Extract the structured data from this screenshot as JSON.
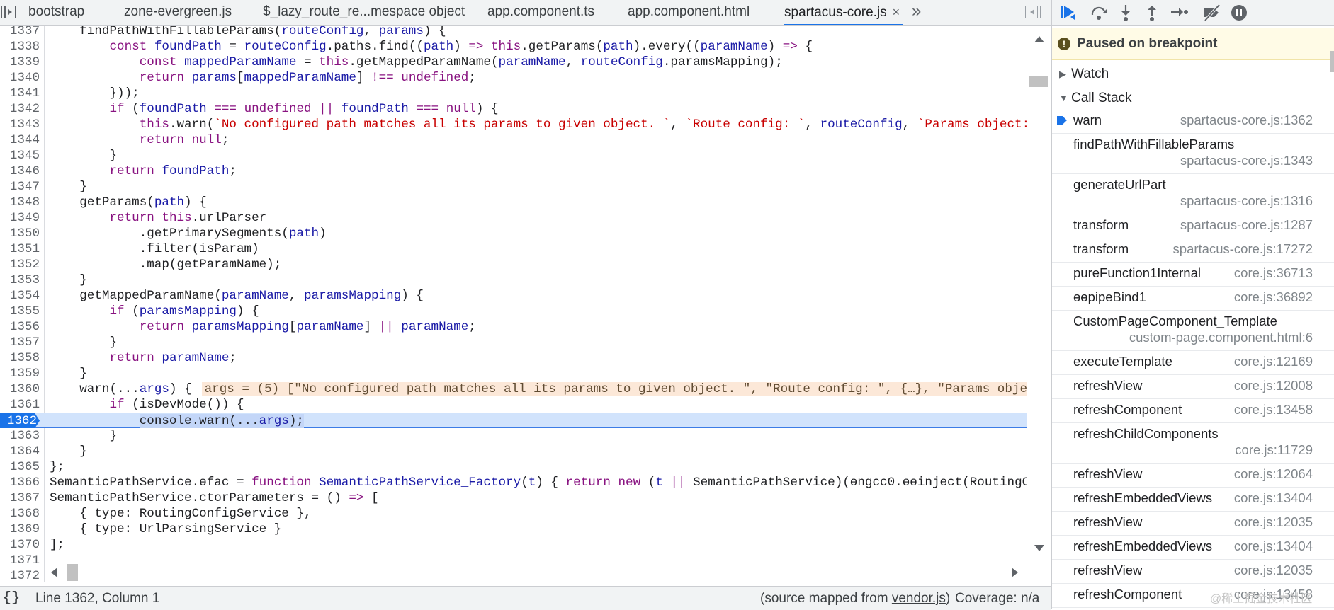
{
  "tabs": [
    {
      "label": "bootstrap"
    },
    {
      "label": "zone-evergreen.js"
    },
    {
      "label": "$_lazy_route_re...mespace object"
    },
    {
      "label": "app.component.ts"
    },
    {
      "label": "app.component.html"
    },
    {
      "label": "spartacus-core.js",
      "active": true,
      "close": "×"
    }
  ],
  "tab_overflow": "»",
  "editor": {
    "lines": [
      {
        "n": "1337"
      },
      {
        "n": "1338"
      },
      {
        "n": "1339"
      },
      {
        "n": "1340"
      },
      {
        "n": "1341"
      },
      {
        "n": "1342"
      },
      {
        "n": "1343"
      },
      {
        "n": "1344"
      },
      {
        "n": "1345"
      },
      {
        "n": "1346"
      },
      {
        "n": "1347"
      },
      {
        "n": "1348"
      },
      {
        "n": "1349"
      },
      {
        "n": "1350"
      },
      {
        "n": "1351"
      },
      {
        "n": "1352"
      },
      {
        "n": "1353"
      },
      {
        "n": "1354"
      },
      {
        "n": "1355"
      },
      {
        "n": "1356"
      },
      {
        "n": "1357"
      },
      {
        "n": "1358"
      },
      {
        "n": "1359"
      },
      {
        "n": "1360"
      },
      {
        "n": "1361"
      },
      {
        "n": "1362"
      },
      {
        "n": "1363"
      },
      {
        "n": "1364"
      },
      {
        "n": "1365"
      },
      {
        "n": "1366"
      },
      {
        "n": "1367"
      },
      {
        "n": "1368"
      },
      {
        "n": "1369"
      },
      {
        "n": "1370"
      },
      {
        "n": "1371"
      },
      {
        "n": "1372"
      }
    ],
    "inline_value": "args = (5) [\"No configured path matches all its params to given object. \", \"Route config: \", {…}, \"Params objec"
  },
  "status": {
    "pretty_print": "{}",
    "cursor": "Line 1362, Column 1",
    "source_mapped_prefix": "(source mapped from ",
    "source_mapped_file": "vendor.js",
    "source_mapped_suffix": ")",
    "coverage": "Coverage: n/a"
  },
  "debugger": {
    "paused_message": "Paused on breakpoint",
    "info_glyph": "!",
    "watch_label": "Watch",
    "callstack_label": "Call Stack",
    "collapsed_glyph": "▶",
    "expanded_glyph": "▼",
    "frames": [
      {
        "name": "warn",
        "location": "spartacus-core.js:1362",
        "current": true
      },
      {
        "name": "findPathWithFillableParams",
        "location": "spartacus-core.js:1343",
        "two_line": true
      },
      {
        "name": "generateUrlPart",
        "location": "spartacus-core.js:1316",
        "two_line": true
      },
      {
        "name": "transform",
        "location": "spartacus-core.js:1287"
      },
      {
        "name": "transform",
        "location": "spartacus-core.js:17272"
      },
      {
        "name": "pureFunction1Internal",
        "location": "core.js:36713"
      },
      {
        "name": "ɵɵpipeBind1",
        "location": "core.js:36892"
      },
      {
        "name": "CustomPageComponent_Template",
        "location": "custom-page.component.html:6",
        "two_line": true
      },
      {
        "name": "executeTemplate",
        "location": "core.js:12169"
      },
      {
        "name": "refreshView",
        "location": "core.js:12008"
      },
      {
        "name": "refreshComponent",
        "location": "core.js:13458"
      },
      {
        "name": "refreshChildComponents",
        "location": "core.js:11729",
        "two_line": true
      },
      {
        "name": "refreshView",
        "location": "core.js:12064"
      },
      {
        "name": "refreshEmbeddedViews",
        "location": "core.js:13404"
      },
      {
        "name": "refreshView",
        "location": "core.js:12035"
      },
      {
        "name": "refreshEmbeddedViews",
        "location": "core.js:13404"
      },
      {
        "name": "refreshView",
        "location": "core.js:12035"
      },
      {
        "name": "refreshComponent",
        "location": "core.js:13458"
      }
    ]
  },
  "icons": {
    "navigator_toggle": "navigator-toggle-icon",
    "debugger_toggle": "debugger-sidebar-toggle-icon",
    "resume": "resume-icon",
    "step_over": "step-over-icon",
    "step_into": "step-into-icon",
    "step_out": "step-out-icon",
    "step": "step-icon",
    "deactivate_breakpoints": "deactivate-breakpoints-icon",
    "pause_on_exceptions": "pause-on-exceptions-icon"
  },
  "colors": {
    "accent": "#1a73e8",
    "keyword": "#881280",
    "identifier": "#1a1aa6",
    "string": "#c80000",
    "paused_banner": "#fffbe6",
    "inline_value_bg": "#fce8d8"
  },
  "watermark": "@稀土掘金技术社区"
}
